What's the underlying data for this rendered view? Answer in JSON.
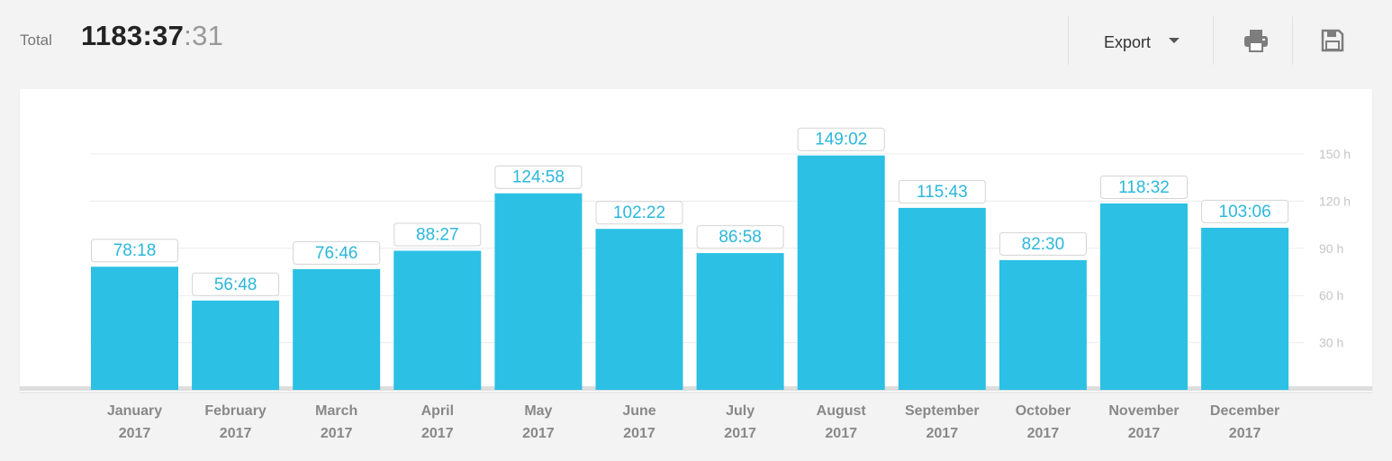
{
  "header": {
    "total_label": "Total",
    "total_value_main": "1183:37",
    "total_value_seconds": ":31",
    "export_label": "Export",
    "print_icon": "printer-icon",
    "save_icon": "floppy-disk-icon"
  },
  "colors": {
    "bar": "#2bc0e4",
    "label_text": "#2bb7dc",
    "axis_text": "#c4c4c4",
    "category_text": "#888888",
    "gridline": "#ececec",
    "baseline": "#dddddd"
  },
  "chart_data": {
    "type": "bar",
    "categories": [
      [
        "January",
        "2017"
      ],
      [
        "February",
        "2017"
      ],
      [
        "March",
        "2017"
      ],
      [
        "April",
        "2017"
      ],
      [
        "May",
        "2017"
      ],
      [
        "June",
        "2017"
      ],
      [
        "July",
        "2017"
      ],
      [
        "August",
        "2017"
      ],
      [
        "September",
        "2017"
      ],
      [
        "October",
        "2017"
      ],
      [
        "November",
        "2017"
      ],
      [
        "December",
        "2017"
      ]
    ],
    "values": [
      78.3,
      56.8,
      76.767,
      88.45,
      124.967,
      102.367,
      86.967,
      149.033,
      115.717,
      82.5,
      118.533,
      103.1
    ],
    "value_labels": [
      "78:18",
      "56:48",
      "76:46",
      "88:27",
      "124:58",
      "102:22",
      "86:58",
      "149:02",
      "115:43",
      "82:30",
      "118:32",
      "103:06"
    ],
    "y_ticks": [
      30,
      60,
      90,
      120,
      150
    ],
    "y_tick_labels": [
      "30 h",
      "60 h",
      "90 h",
      "120 h",
      "150 h"
    ],
    "ylim": [
      0,
      150
    ],
    "grid": true,
    "y_axis_position": "right"
  }
}
